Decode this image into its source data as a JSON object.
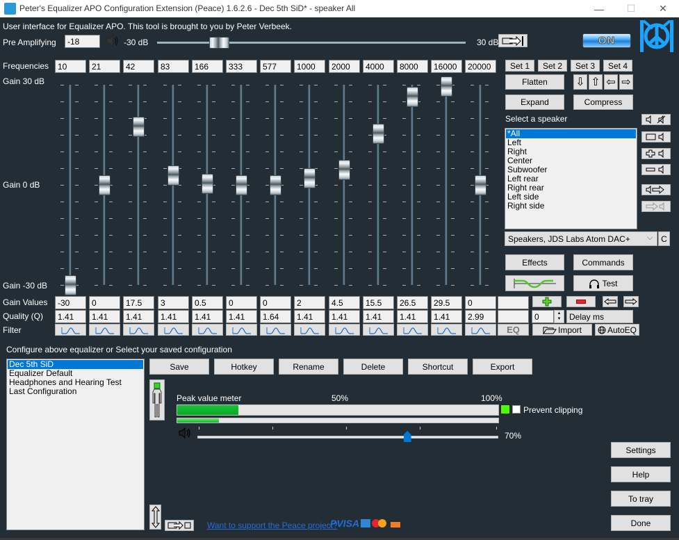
{
  "window": {
    "title": "Peter's Equalizer APO Configuration Extension (Peace) 1.6.2.6 - Dec 5th SiD* - speaker All",
    "minimize": "—",
    "maximize": "☐",
    "close": "✕"
  },
  "header": {
    "intro": "User interface for Equalizer APO. This tool is brought to you by Peter Verbeek.",
    "pre_amp_label": "Pre Amplifying",
    "pre_amp_value": "-18",
    "pre_amp_min": "-30 dB",
    "pre_amp_max": "30 dB",
    "pre_amp_range_db": [
      -30,
      30
    ],
    "pre_amp_db": -18,
    "power_label": "ON"
  },
  "eq": {
    "frequencies_label": "Frequencies",
    "gain_top": "Gain 30 dB",
    "gain_mid": "Gain 0 dB",
    "gain_bottom": "Gain -30 dB",
    "gain_values_label": "Gain Values",
    "quality_label": "Quality (Q)",
    "filter_label": "Filter",
    "gain_range_db": [
      -30,
      30
    ],
    "bands": [
      {
        "freq": "10",
        "gain": "-30",
        "q": "1.41",
        "gain_db": -30
      },
      {
        "freq": "21",
        "gain": "0",
        "q": "1.41",
        "gain_db": 0
      },
      {
        "freq": "42",
        "gain": "17.5",
        "q": "1.41",
        "gain_db": 17.5
      },
      {
        "freq": "83",
        "gain": "3",
        "q": "1.41",
        "gain_db": 3
      },
      {
        "freq": "166",
        "gain": "0.5",
        "q": "1.41",
        "gain_db": 0.5
      },
      {
        "freq": "333",
        "gain": "0",
        "q": "1.41",
        "gain_db": 0
      },
      {
        "freq": "577",
        "gain": "0",
        "q": "1.64",
        "gain_db": 0
      },
      {
        "freq": "1000",
        "gain": "2",
        "q": "1.41",
        "gain_db": 2
      },
      {
        "freq": "2000",
        "gain": "4.5",
        "q": "1.41",
        "gain_db": 4.5
      },
      {
        "freq": "4000",
        "gain": "15.5",
        "q": "1.41",
        "gain_db": 15.5
      },
      {
        "freq": "8000",
        "gain": "26.5",
        "q": "1.41",
        "gain_db": 26.5
      },
      {
        "freq": "16000",
        "gain": "29.5",
        "q": "1.41",
        "gain_db": 29.5
      },
      {
        "freq": "20000",
        "gain": "0",
        "q": "2.99",
        "gain_db": 0
      }
    ]
  },
  "right_panel": {
    "sets": [
      "Set 1",
      "Set 2",
      "Set 3",
      "Set 4"
    ],
    "flatten": "Flatten",
    "expand": "Expand",
    "compress": "Compress",
    "arrows": [
      "⇩",
      "⇧",
      "⇦",
      "⇨"
    ],
    "select_speaker_label": "Select a speaker",
    "speakers": [
      "*All",
      "Left",
      "Right",
      "Center",
      "Subwoofer",
      "Left rear",
      "Right rear",
      "Left side",
      "Right side"
    ],
    "selected_speaker": "*All",
    "device": "Speakers, JDS Labs Atom DAC+",
    "device_c": "C",
    "effects": "Effects",
    "commands": "Commands",
    "test": "Test",
    "delay_value": "0",
    "delay_label": "Delay ms",
    "eq_label": "EQ",
    "import": "Import",
    "autoeq": "AutoEQ"
  },
  "config": {
    "label": "Configure above equalizer or Select your saved configuration",
    "items": [
      "Dec 5th SiD",
      "Equalizer Default",
      "Headphones and Hearing Test",
      "Last Configuration"
    ],
    "selected": "Dec 5th SiD",
    "buttons": [
      "Save",
      "Hotkey",
      "Rename",
      "Delete",
      "Shortcut",
      "Export"
    ]
  },
  "meter": {
    "label": "Peak value meter",
    "mark_50": "50%",
    "mark_100": "100%",
    "peak_fraction": 0.19,
    "peak_fraction_2": 0.13,
    "prevent_clipping": "Prevent clipping",
    "volume_percent_label": "70%",
    "volume_fraction": 0.7,
    "clip_indicator_color": "#4cff00"
  },
  "side_buttons": {
    "settings": "Settings",
    "help": "Help",
    "to_tray": "To tray",
    "done": "Done"
  },
  "footer": {
    "support_link": "Want to support the Peace project?",
    "payment": "PVISA"
  },
  "colors": {
    "background": "#222d35",
    "accent": "#0078d7",
    "logo": "#1aa3ff"
  }
}
